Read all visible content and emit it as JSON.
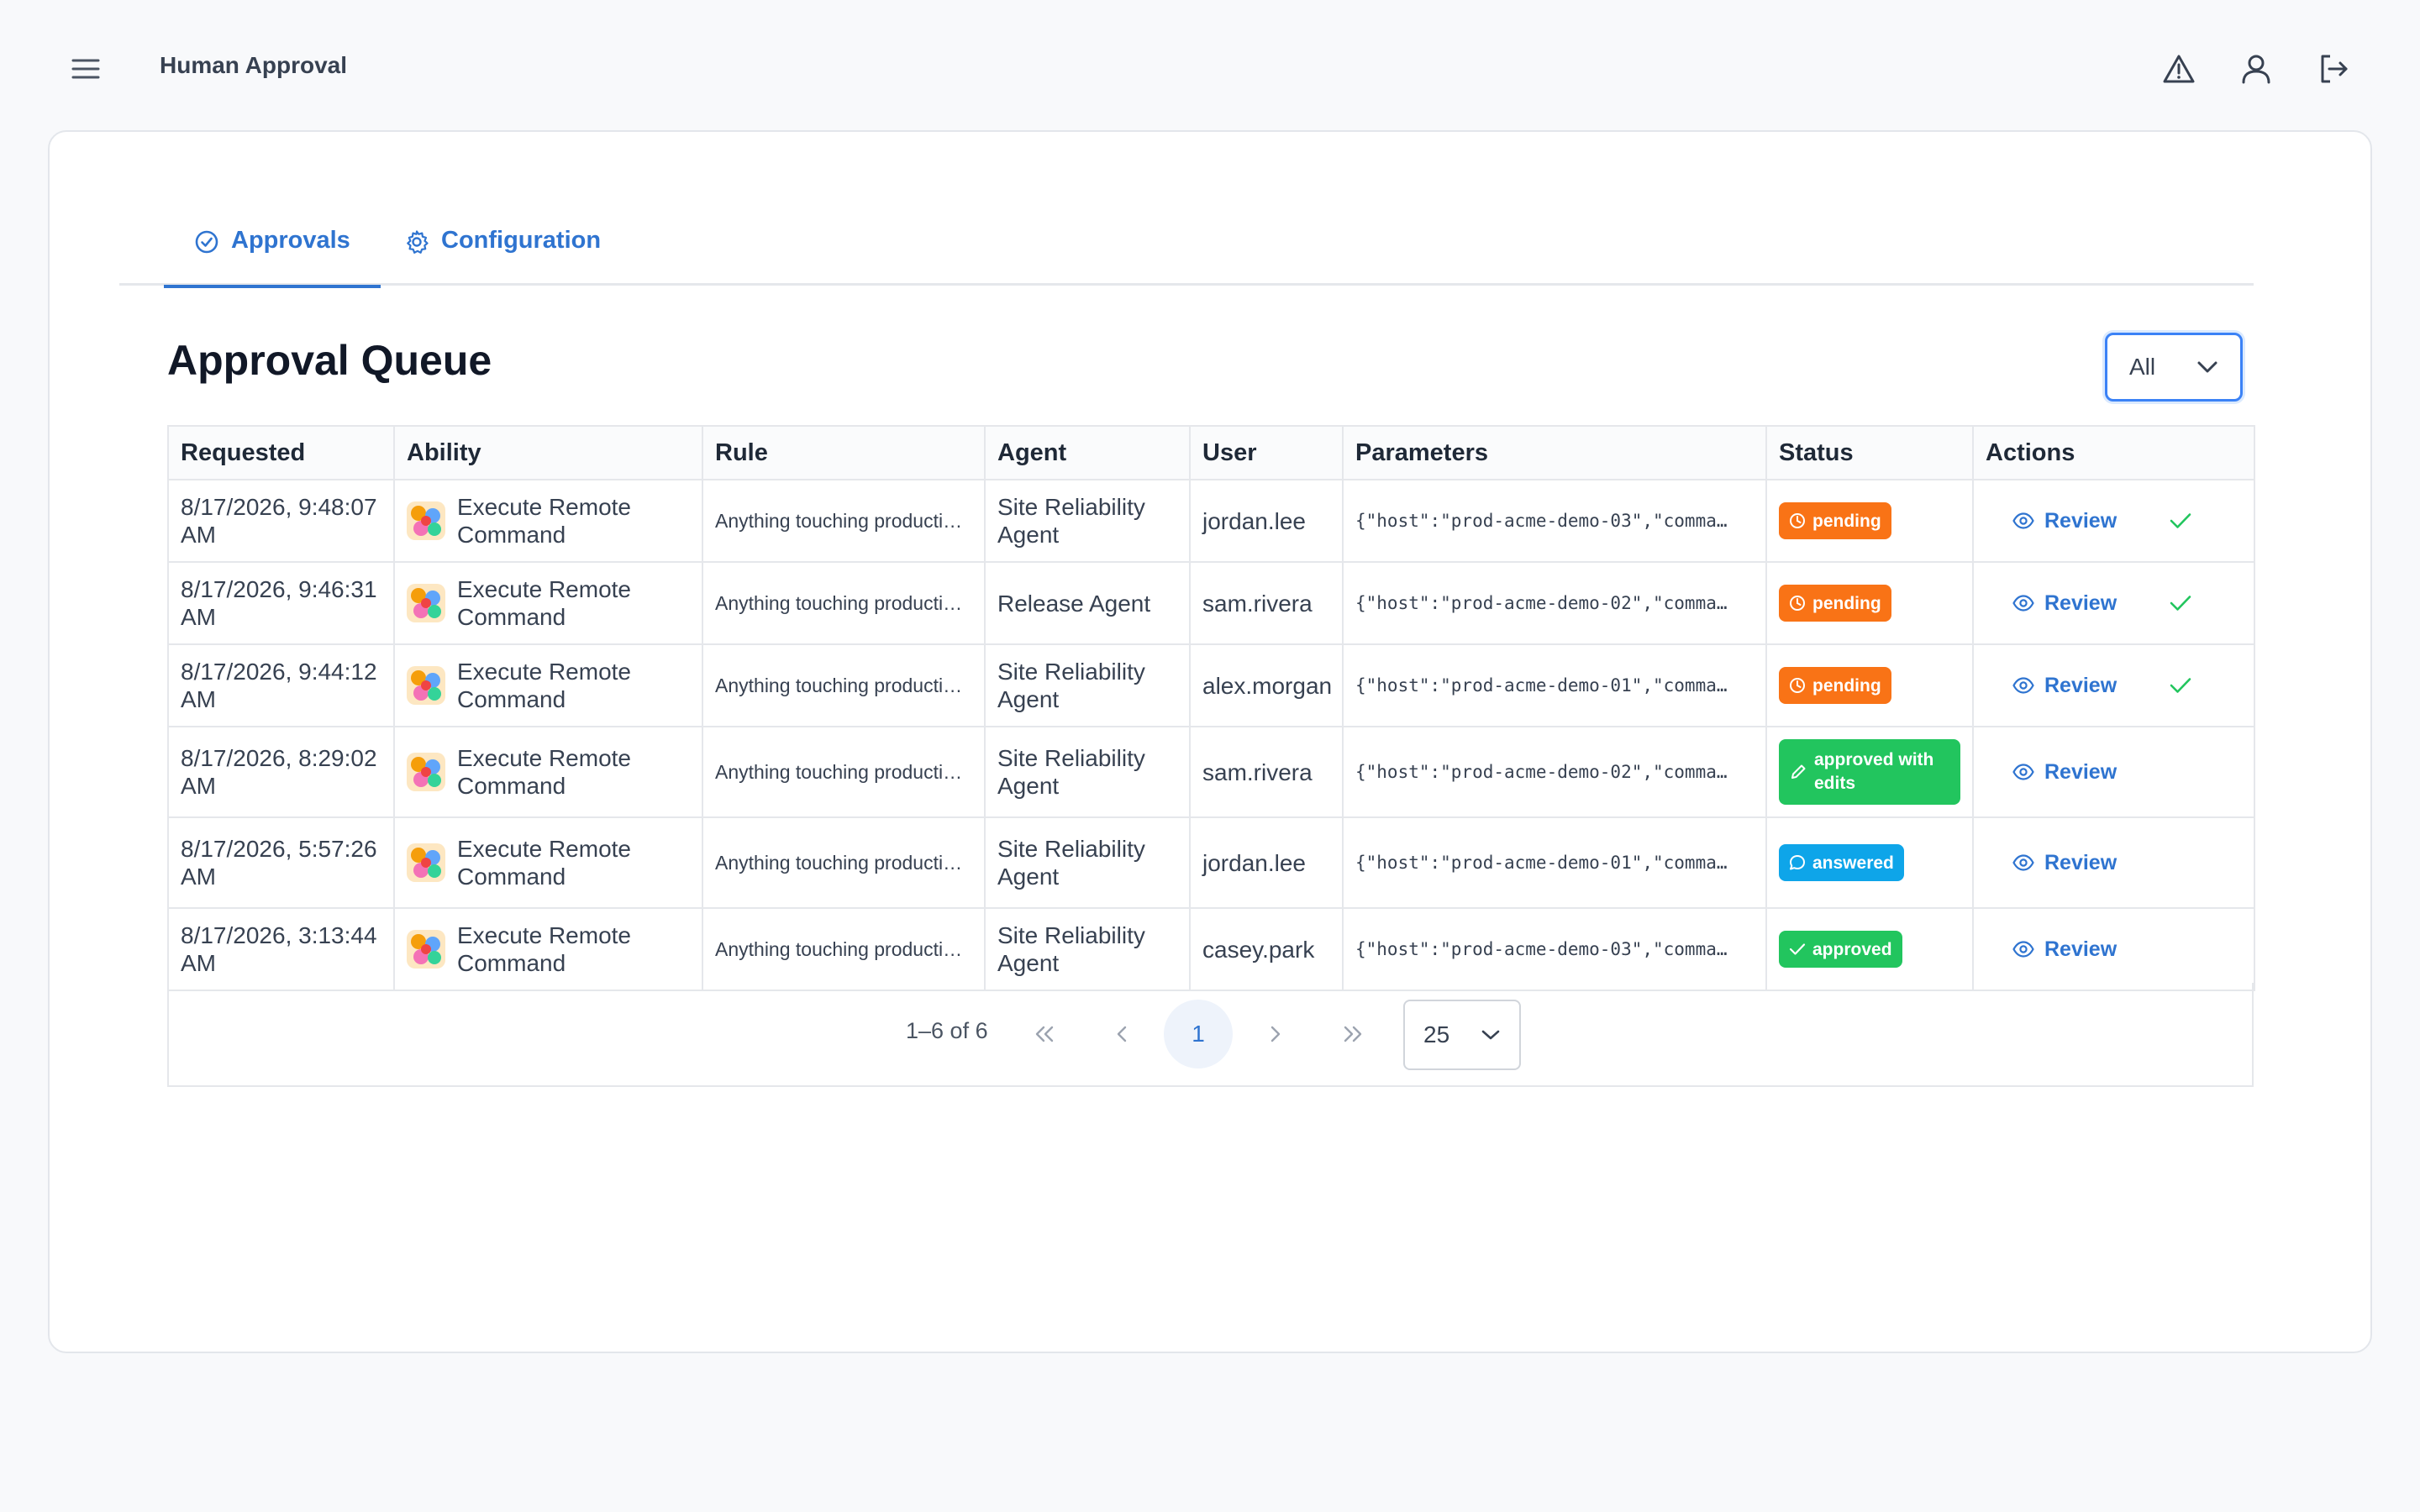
{
  "header": {
    "title": "Human Approval",
    "icons": [
      "menu-icon",
      "alert-triangle-icon",
      "user-icon",
      "logout-icon"
    ]
  },
  "tabs": [
    {
      "label": "Approvals",
      "icon": "check-circle-icon",
      "active": true
    },
    {
      "label": "Configuration",
      "icon": "gear-icon",
      "active": false
    }
  ],
  "page_title": "Approval Queue",
  "filter": {
    "value": "All"
  },
  "table": {
    "columns": [
      "Requested",
      "Ability",
      "Rule",
      "Agent",
      "User",
      "Parameters",
      "Status",
      "Actions"
    ],
    "rows": [
      {
        "requested": "8/17/2026, 9:48:07 AM",
        "ability": "Execute Remote Command",
        "rule": "Anything touching productio…",
        "agent": "Site Reliability Agent",
        "user": "jordan.lee",
        "parameters": "{\"host\":\"prod-acme-demo-03\",\"comma…",
        "status": "pending",
        "action": "Review"
      },
      {
        "requested": "8/17/2026, 9:46:31 AM",
        "ability": "Execute Remote Command",
        "rule": "Anything touching productio…",
        "agent": "Release Agent",
        "user": "sam.rivera",
        "parameters": "{\"host\":\"prod-acme-demo-02\",\"comma…",
        "status": "pending",
        "action": "Review"
      },
      {
        "requested": "8/17/2026, 9:44:12 AM",
        "ability": "Execute Remote Command",
        "rule": "Anything touching productio…",
        "agent": "Site Reliability Agent",
        "user": "alex.morgan",
        "parameters": "{\"host\":\"prod-acme-demo-01\",\"comma…",
        "status": "pending",
        "action": "Review"
      },
      {
        "requested": "8/17/2026, 8:29:02 AM",
        "ability": "Execute Remote Command",
        "rule": "Anything touching productio…",
        "agent": "Site Reliability Agent",
        "user": "sam.rivera",
        "parameters": "{\"host\":\"prod-acme-demo-02\",\"comma…",
        "status": "approved with edits",
        "action": "Review"
      },
      {
        "requested": "8/17/2026, 5:57:26 AM",
        "ability": "Execute Remote Command",
        "rule": "Anything touching productio…",
        "agent": "Site Reliability Agent",
        "user": "jordan.lee",
        "parameters": "{\"host\":\"prod-acme-demo-01\",\"comma…",
        "status": "answered",
        "action": "Review"
      },
      {
        "requested": "8/17/2026, 3:13:44 AM",
        "ability": "Execute Remote Command",
        "rule": "Anything touching productio…",
        "agent": "Site Reliability Agent",
        "user": "casey.park",
        "parameters": "{\"host\":\"prod-acme-demo-03\",\"comma…",
        "status": "approved",
        "action": "Review"
      }
    ]
  },
  "pagination": {
    "range": "1–6 of 6",
    "current_page": "1",
    "page_size": "25"
  },
  "colors": {
    "accent": "#2f74d0",
    "pending": "#f97316",
    "approved": "#22c55e",
    "answered": "#0ea5e9"
  }
}
